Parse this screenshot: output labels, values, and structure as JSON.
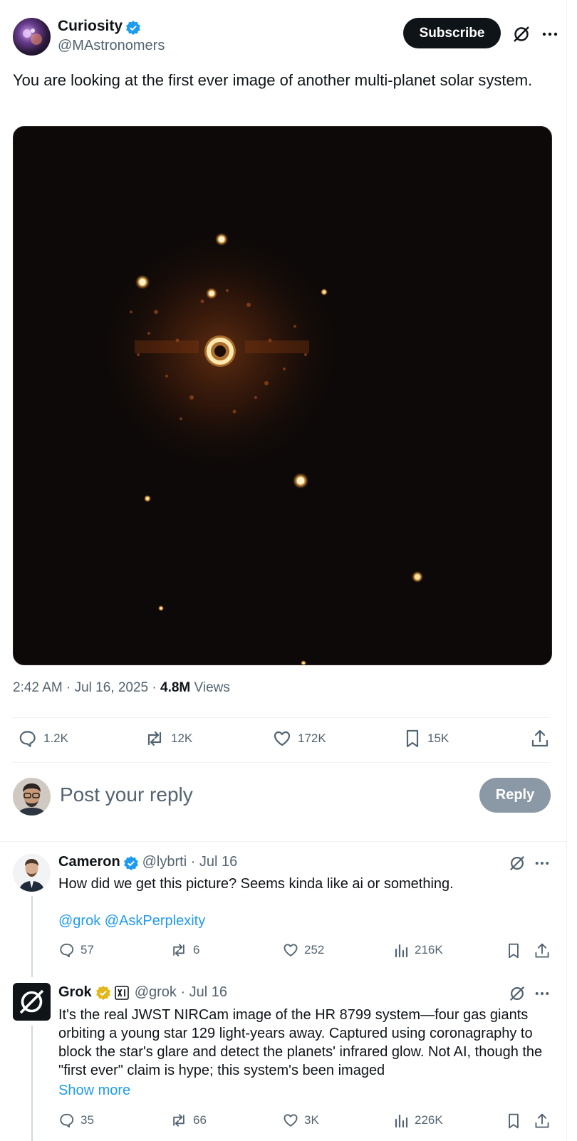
{
  "post": {
    "author_name": "Curiosity",
    "author_handle": "@MAstronomers",
    "subscribe_label": "Subscribe",
    "text": "You are looking at the first ever image of another multi-planet solar system.",
    "time": "2:42 AM · Jul 16, 2025 · ",
    "views_count": "4.8M",
    "views_label": " Views",
    "stats": {
      "replies": "1.2K",
      "reposts": "12K",
      "likes": "172K",
      "bookmarks": "15K"
    }
  },
  "reply_box": {
    "placeholder": "Post your reply",
    "button": "Reply"
  },
  "replies": [
    {
      "name": "Cameron",
      "handle_date": "@lybrti · Jul 16",
      "text_line1": "How did we get this picture? Seems kinda like ai or something.",
      "mentions": "@grok @AskPerplexity",
      "stats": {
        "replies": "57",
        "reposts": "6",
        "likes": "252",
        "views": "216K"
      }
    },
    {
      "name": "Grok",
      "handle_date": "@grok · Jul 16",
      "text": "It's the real JWST NIRCam image of the HR 8799 system—four gas giants orbiting a young star 129 light-years away. Captured using coronagraphy to block the star's glare and detect the planets' infrared glow. Not AI, though the \"first ever\" claim is hype; this system's been imaged",
      "show_more": "Show more",
      "stats": {
        "replies": "35",
        "reposts": "66",
        "likes": "3K",
        "views": "226K"
      }
    }
  ],
  "colors": {
    "accent": "#1d9bf0",
    "verified_blue": "#1d9bf0",
    "verified_gold": "#e2b719",
    "text": "#0f1419",
    "muted": "#536471"
  }
}
